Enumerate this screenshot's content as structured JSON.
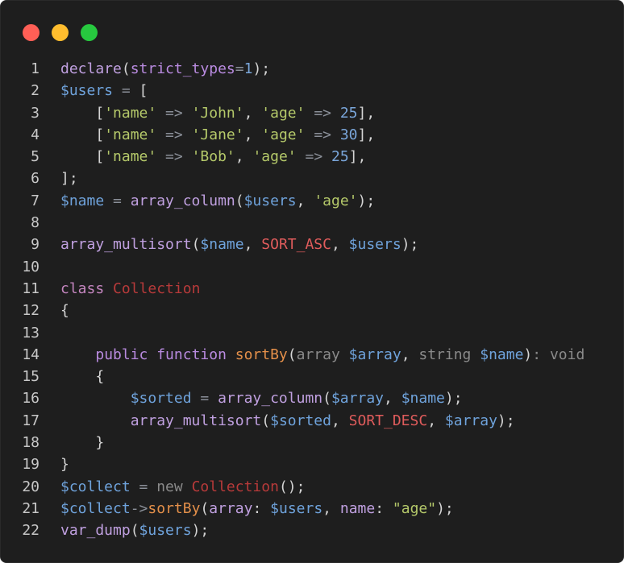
{
  "window": {
    "controls": [
      {
        "name": "close",
        "color": "#ff5f56"
      },
      {
        "name": "minimize",
        "color": "#ffbd2e"
      },
      {
        "name": "maximize",
        "color": "#27c93f"
      }
    ]
  },
  "code": {
    "language": "php",
    "lines": [
      {
        "n": "1",
        "tokens": [
          [
            "fn",
            "declare"
          ],
          [
            "pun",
            "("
          ],
          [
            "kw2",
            "strict_types"
          ],
          [
            "op",
            "="
          ],
          [
            "num",
            "1"
          ],
          [
            "pun",
            ");"
          ]
        ]
      },
      {
        "n": "2",
        "tokens": [
          [
            "var",
            "$users"
          ],
          [
            "op",
            " = "
          ],
          [
            "pun",
            "["
          ]
        ]
      },
      {
        "n": "3",
        "tokens": [
          [
            "pun",
            "    ["
          ],
          [
            "str",
            "'name'"
          ],
          [
            "op",
            " => "
          ],
          [
            "str",
            "'John'"
          ],
          [
            "pun",
            ", "
          ],
          [
            "str",
            "'age'"
          ],
          [
            "op",
            " => "
          ],
          [
            "num",
            "25"
          ],
          [
            "pun",
            "],"
          ]
        ]
      },
      {
        "n": "4",
        "tokens": [
          [
            "pun",
            "    ["
          ],
          [
            "str",
            "'name'"
          ],
          [
            "op",
            " => "
          ],
          [
            "str",
            "'Jane'"
          ],
          [
            "pun",
            ", "
          ],
          [
            "str",
            "'age'"
          ],
          [
            "op",
            " => "
          ],
          [
            "num",
            "30"
          ],
          [
            "pun",
            "],"
          ]
        ]
      },
      {
        "n": "5",
        "tokens": [
          [
            "pun",
            "    ["
          ],
          [
            "str",
            "'name'"
          ],
          [
            "op",
            " => "
          ],
          [
            "str",
            "'Bob'"
          ],
          [
            "pun",
            ", "
          ],
          [
            "str",
            "'age'"
          ],
          [
            "op",
            " => "
          ],
          [
            "num",
            "25"
          ],
          [
            "pun",
            "],"
          ]
        ]
      },
      {
        "n": "6",
        "tokens": [
          [
            "pun",
            "];"
          ]
        ]
      },
      {
        "n": "7",
        "tokens": [
          [
            "var",
            "$name"
          ],
          [
            "op",
            " = "
          ],
          [
            "fn",
            "array_column"
          ],
          [
            "pun",
            "("
          ],
          [
            "var",
            "$users"
          ],
          [
            "pun",
            ", "
          ],
          [
            "str",
            "'age'"
          ],
          [
            "pun",
            ");"
          ]
        ]
      },
      {
        "n": "8",
        "tokens": []
      },
      {
        "n": "9",
        "tokens": [
          [
            "fn",
            "array_multisort"
          ],
          [
            "pun",
            "("
          ],
          [
            "var",
            "$name"
          ],
          [
            "pun",
            ", "
          ],
          [
            "const",
            "SORT_ASC"
          ],
          [
            "pun",
            ", "
          ],
          [
            "var",
            "$users"
          ],
          [
            "pun",
            ");"
          ]
        ]
      },
      {
        "n": "10",
        "tokens": []
      },
      {
        "n": "11",
        "tokens": [
          [
            "kw",
            "class "
          ],
          [
            "cls",
            "Collection"
          ]
        ]
      },
      {
        "n": "12",
        "tokens": [
          [
            "pun",
            "{"
          ]
        ]
      },
      {
        "n": "13",
        "tokens": []
      },
      {
        "n": "14",
        "tokens": [
          [
            "pun",
            "    "
          ],
          [
            "kw2",
            "public function "
          ],
          [
            "meth",
            "sortBy"
          ],
          [
            "pun",
            "("
          ],
          [
            "type",
            "array "
          ],
          [
            "var",
            "$array"
          ],
          [
            "pun",
            ", "
          ],
          [
            "type",
            "string "
          ],
          [
            "var",
            "$name"
          ],
          [
            "pun",
            ")"
          ],
          [
            "type",
            ": void"
          ]
        ]
      },
      {
        "n": "15",
        "tokens": [
          [
            "pun",
            "    {"
          ]
        ]
      },
      {
        "n": "16",
        "tokens": [
          [
            "pun",
            "        "
          ],
          [
            "var",
            "$sorted"
          ],
          [
            "op",
            " = "
          ],
          [
            "fn",
            "array_column"
          ],
          [
            "pun",
            "("
          ],
          [
            "var",
            "$array"
          ],
          [
            "pun",
            ", "
          ],
          [
            "var",
            "$name"
          ],
          [
            "pun",
            ");"
          ]
        ]
      },
      {
        "n": "17",
        "tokens": [
          [
            "pun",
            "        "
          ],
          [
            "fn",
            "array_multisort"
          ],
          [
            "pun",
            "("
          ],
          [
            "var",
            "$sorted"
          ],
          [
            "pun",
            ", "
          ],
          [
            "const",
            "SORT_DESC"
          ],
          [
            "pun",
            ", "
          ],
          [
            "var",
            "$array"
          ],
          [
            "pun",
            ");"
          ]
        ]
      },
      {
        "n": "18",
        "tokens": [
          [
            "pun",
            "    }"
          ]
        ]
      },
      {
        "n": "19",
        "tokens": [
          [
            "pun",
            "}"
          ]
        ]
      },
      {
        "n": "20",
        "tokens": [
          [
            "var",
            "$collect"
          ],
          [
            "op",
            " = "
          ],
          [
            "type",
            "new "
          ],
          [
            "cls",
            "Collection"
          ],
          [
            "pun",
            "();"
          ]
        ]
      },
      {
        "n": "21",
        "tokens": [
          [
            "var",
            "$collect"
          ],
          [
            "op",
            "->"
          ],
          [
            "meth",
            "sortBy"
          ],
          [
            "pun",
            "("
          ],
          [
            "fn",
            "array"
          ],
          [
            "pun",
            ": "
          ],
          [
            "var",
            "$users"
          ],
          [
            "pun",
            ", "
          ],
          [
            "fn",
            "name"
          ],
          [
            "pun",
            ": "
          ],
          [
            "str",
            "\"age\""
          ],
          [
            "pun",
            ");"
          ]
        ]
      },
      {
        "n": "22",
        "tokens": [
          [
            "fn",
            "var_dump"
          ],
          [
            "pun",
            "("
          ],
          [
            "var",
            "$users"
          ],
          [
            "pun",
            ");"
          ]
        ]
      }
    ]
  }
}
